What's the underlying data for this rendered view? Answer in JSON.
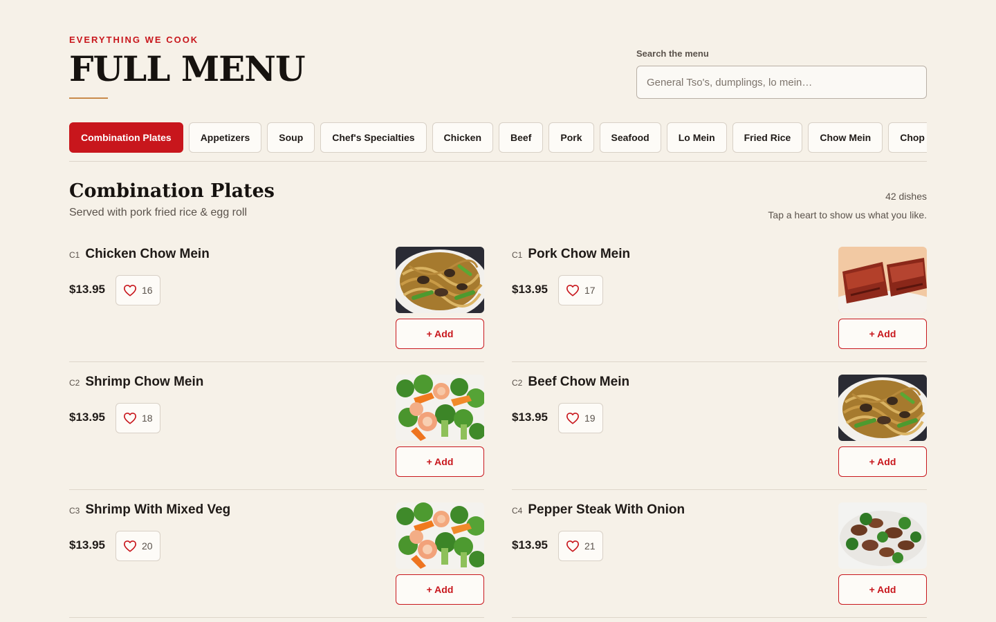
{
  "header": {
    "eyebrow": "EVERYTHING WE COOK",
    "title": "FULL MENU",
    "search_label": "Search the menu",
    "search_placeholder": "General Tso's, dumplings, lo mein…",
    "search_value": ""
  },
  "tabs": [
    {
      "label": "Combination Plates",
      "active": true
    },
    {
      "label": "Appetizers"
    },
    {
      "label": "Soup"
    },
    {
      "label": "Chef's Specialties"
    },
    {
      "label": "Chicken"
    },
    {
      "label": "Beef"
    },
    {
      "label": "Pork"
    },
    {
      "label": "Seafood"
    },
    {
      "label": "Lo Mein"
    },
    {
      "label": "Fried Rice"
    },
    {
      "label": "Chow Mein"
    },
    {
      "label": "Chop Suey"
    }
  ],
  "section": {
    "title": "Combination Plates",
    "subtitle": "Served with pork fried rice & egg roll",
    "count": "42 dishes",
    "hint": "Tap a heart to show us what you like."
  },
  "items": [
    {
      "code": "C1",
      "name": "Chicken Chow Mein",
      "price": "$13.95",
      "likes": "16",
      "image": "noodles",
      "add_label": "+ Add"
    },
    {
      "code": "C1",
      "name": "Pork Chow Mein",
      "price": "$13.95",
      "likes": "17",
      "image": "spare-ribs",
      "add_label": "+ Add"
    },
    {
      "code": "C2",
      "name": "Shrimp Chow Mein",
      "price": "$13.95",
      "likes": "18",
      "image": "shrimp-broccoli",
      "add_label": "+ Add"
    },
    {
      "code": "C2",
      "name": "Beef Chow Mein",
      "price": "$13.95",
      "likes": "19",
      "image": "noodles",
      "add_label": "+ Add"
    },
    {
      "code": "C3",
      "name": "Shrimp With Mixed Veg",
      "price": "$13.95",
      "likes": "20",
      "image": "shrimp-broccoli",
      "add_label": "+ Add"
    },
    {
      "code": "C4",
      "name": "Pepper Steak With Onion",
      "price": "$13.95",
      "likes": "21",
      "image": "beef-broccoli",
      "add_label": "+ Add"
    }
  ],
  "colors": {
    "accent": "#c8161c",
    "background": "#f6f1e8",
    "rule_gold": "#c98a4a"
  }
}
